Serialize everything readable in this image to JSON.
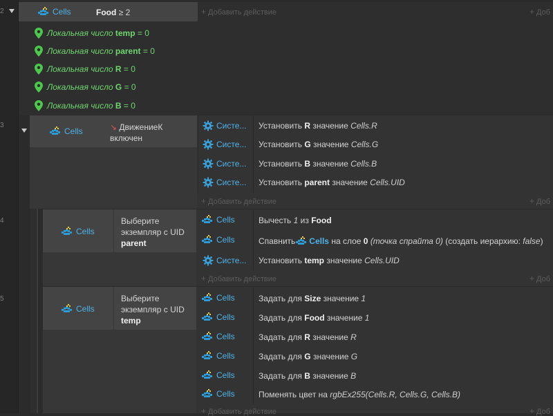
{
  "events": [
    {
      "number": "2",
      "object": "Cells",
      "condition": {
        "label": "Food",
        "op": "≥",
        "value": "2"
      },
      "add_action": "Добавить действие",
      "add_right": "Доб"
    },
    {
      "number": "3",
      "object": "Cells",
      "condition": {
        "line1": "ДвижениеК",
        "line2": "включен"
      },
      "add_action": "Добавить действие",
      "add_right": "Доб"
    },
    {
      "number": "4",
      "object": "Cells",
      "condition": {
        "line1": "Выберите",
        "line2": "экземпляр с UID",
        "param": "parent"
      },
      "add_action": "Добавить действие",
      "add_right": "Доб"
    },
    {
      "number": "5",
      "object": "Cells",
      "condition": {
        "line1": "Выберите",
        "line2": "экземпляр с UID",
        "param": "temp"
      },
      "add_action": "Добавить действие",
      "add_right": "Доб"
    }
  ],
  "locals": [
    {
      "prefix": "Локальная число",
      "name": "temp",
      "eq": "=",
      "value": "0"
    },
    {
      "prefix": "Локальная число",
      "name": "parent",
      "eq": "=",
      "value": "0"
    },
    {
      "prefix": "Локальная число",
      "name": "R",
      "eq": "=",
      "value": "0"
    },
    {
      "prefix": "Локальная число",
      "name": "G",
      "eq": "=",
      "value": "0"
    },
    {
      "prefix": "Локальная число",
      "name": "B",
      "eq": "=",
      "value": "0"
    }
  ],
  "actions3": [
    {
      "obj": "Систе...",
      "pre": "Установить ",
      "var": "R",
      "mid": " значение ",
      "expr": "Cells.R"
    },
    {
      "obj": "Систе...",
      "pre": "Установить ",
      "var": "G",
      "mid": " значение ",
      "expr": "Cells.G"
    },
    {
      "obj": "Систе...",
      "pre": "Установить ",
      "var": "B",
      "mid": " значение ",
      "expr": "Cells.B"
    },
    {
      "obj": "Систе...",
      "pre": "Установить ",
      "var": "parent",
      "mid": " значение ",
      "expr": "Cells.UID"
    }
  ],
  "actions4": {
    "a1": {
      "obj": "Cells",
      "pre": "Вычесть ",
      "num": "1",
      "mid": " из ",
      "var": "Food"
    },
    "a2": {
      "obj": "Cells",
      "pre": "Спавнить ",
      "spawn_obj": "Cells",
      "mid": " на слое ",
      "layer": "0",
      "paren1": "(точка спрайта 0)",
      "paren2_pre": " (создать иерархию: ",
      "paren2_val": "false",
      "paren2_post": ")"
    },
    "a3": {
      "obj": "Систе...",
      "pre": "Установить ",
      "var": "temp",
      "mid": " значение ",
      "expr": "Cells.UID"
    }
  },
  "actions5": [
    {
      "obj": "Cells",
      "pre": "Задать для ",
      "var": "Size",
      "mid": " значение ",
      "expr": "1"
    },
    {
      "obj": "Cells",
      "pre": "Задать для ",
      "var": "Food",
      "mid": " значение ",
      "expr": "1"
    },
    {
      "obj": "Cells",
      "pre": "Задать для ",
      "var": "R",
      "mid": " значение ",
      "expr": "R"
    },
    {
      "obj": "Cells",
      "pre": "Задать для ",
      "var": "G",
      "mid": " значение ",
      "expr": "G"
    },
    {
      "obj": "Cells",
      "pre": "Задать для ",
      "var": "B",
      "mid": " значение ",
      "expr": "B"
    },
    {
      "obj": "Cells",
      "pre": "Поменять цвет на ",
      "expr": "rgbEx255(Cells.R, Cells.G, Cells.B)"
    }
  ],
  "colors": {
    "object": "#4fb3e8",
    "local": "#6fd66f",
    "background": "#2b2b2b"
  }
}
